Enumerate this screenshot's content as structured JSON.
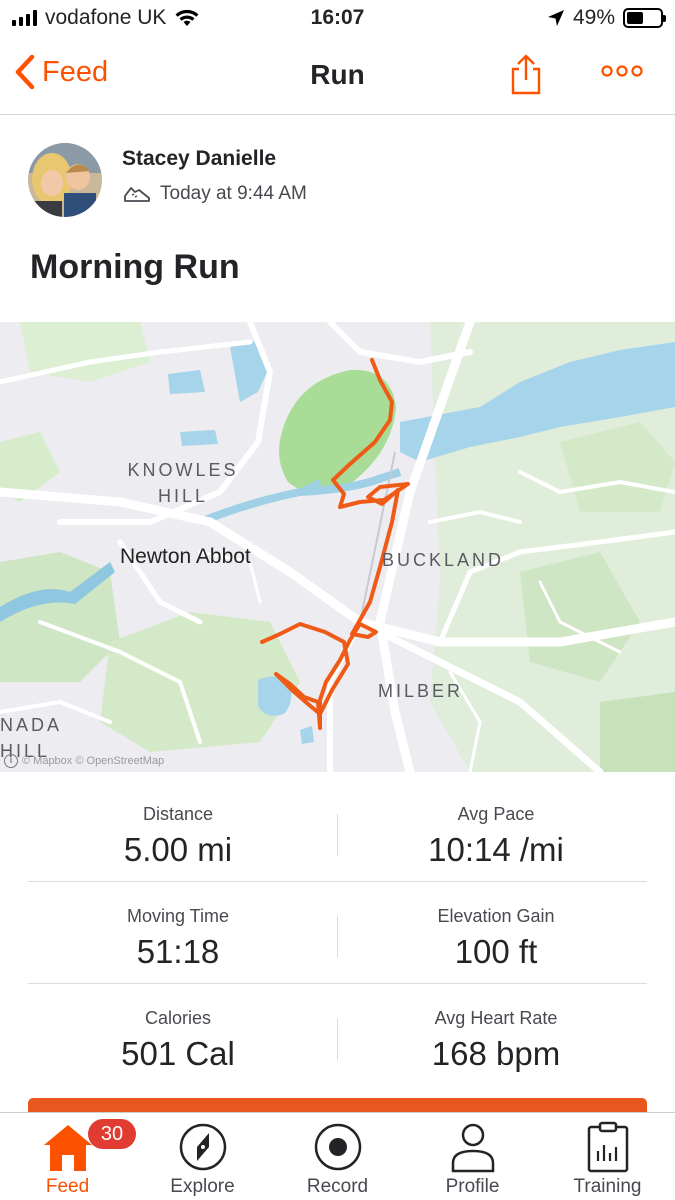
{
  "status_bar": {
    "carrier": "vodafone UK",
    "time": "16:07",
    "battery": "49%",
    "battery_level": 0.49
  },
  "nav": {
    "back_label": "Feed",
    "title": "Run"
  },
  "activity": {
    "athlete_name": "Stacey Danielle",
    "timestamp": "Today at 9:44 AM",
    "title": "Morning Run"
  },
  "map": {
    "labels": {
      "knowles": "KNOWLES",
      "hill": "HILL",
      "newton_abbot": "Newton Abbot",
      "buckland": "BUCKLAND",
      "milber": "MILBER",
      "nada": "NADA",
      "nada_hill": "HILL"
    },
    "attribution": "© Mapbox © OpenStreetMap",
    "route_color": "#ef5a16"
  },
  "stats": [
    {
      "left": {
        "label": "Distance",
        "value": "5.00 mi"
      },
      "right": {
        "label": "Avg Pace",
        "value": "10:14 /mi"
      }
    },
    {
      "left": {
        "label": "Moving Time",
        "value": "51:18"
      },
      "right": {
        "label": "Elevation Gain",
        "value": "100 ft"
      }
    },
    {
      "left": {
        "label": "Calories",
        "value": "501 Cal"
      },
      "right": {
        "label": "Avg Heart Rate",
        "value": "168 bpm"
      }
    }
  ],
  "tabs": [
    {
      "label": "Feed",
      "badge": "30",
      "icon": "home-icon",
      "active": true
    },
    {
      "label": "Explore",
      "icon": "compass-icon"
    },
    {
      "label": "Record",
      "icon": "record-icon"
    },
    {
      "label": "Profile",
      "icon": "person-icon"
    },
    {
      "label": "Training",
      "icon": "clipboard-chart-icon"
    }
  ],
  "colors": {
    "accent": "#fc5200",
    "badge": "#e03c31",
    "text": "#242428"
  }
}
